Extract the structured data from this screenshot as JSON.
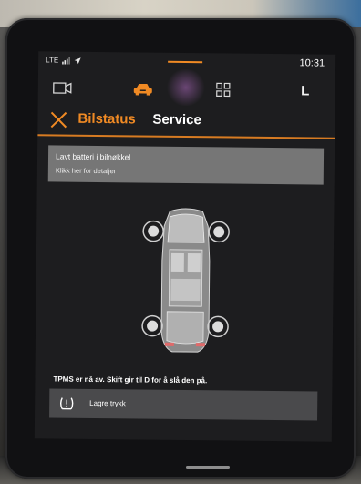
{
  "status_bar": {
    "network": "LTE",
    "time": "10:31",
    "icons": [
      "signal-icon",
      "location-arrow-icon"
    ]
  },
  "nav": {
    "profile_letter": "L",
    "icons": [
      "camera-icon",
      "car-icon",
      "grid-icon"
    ]
  },
  "header": {
    "tabs": [
      {
        "label": "Bilstatus",
        "active": true
      },
      {
        "label": "Service",
        "active": false
      }
    ]
  },
  "notice": {
    "title": "Lavt batteri i bilnøkkel",
    "subtitle": "Klikk her for detaljer"
  },
  "tpms": {
    "message": "TPMS er nå av. Skift gir til D for å slå den på.",
    "save_label": "Lagre trykk",
    "icon": "tire-pressure-icon"
  },
  "colors": {
    "accent": "#f08a24",
    "screen_bg": "#1d1d1f",
    "notice_bg": "#767676",
    "save_bar_bg": "#4a4a4c"
  }
}
